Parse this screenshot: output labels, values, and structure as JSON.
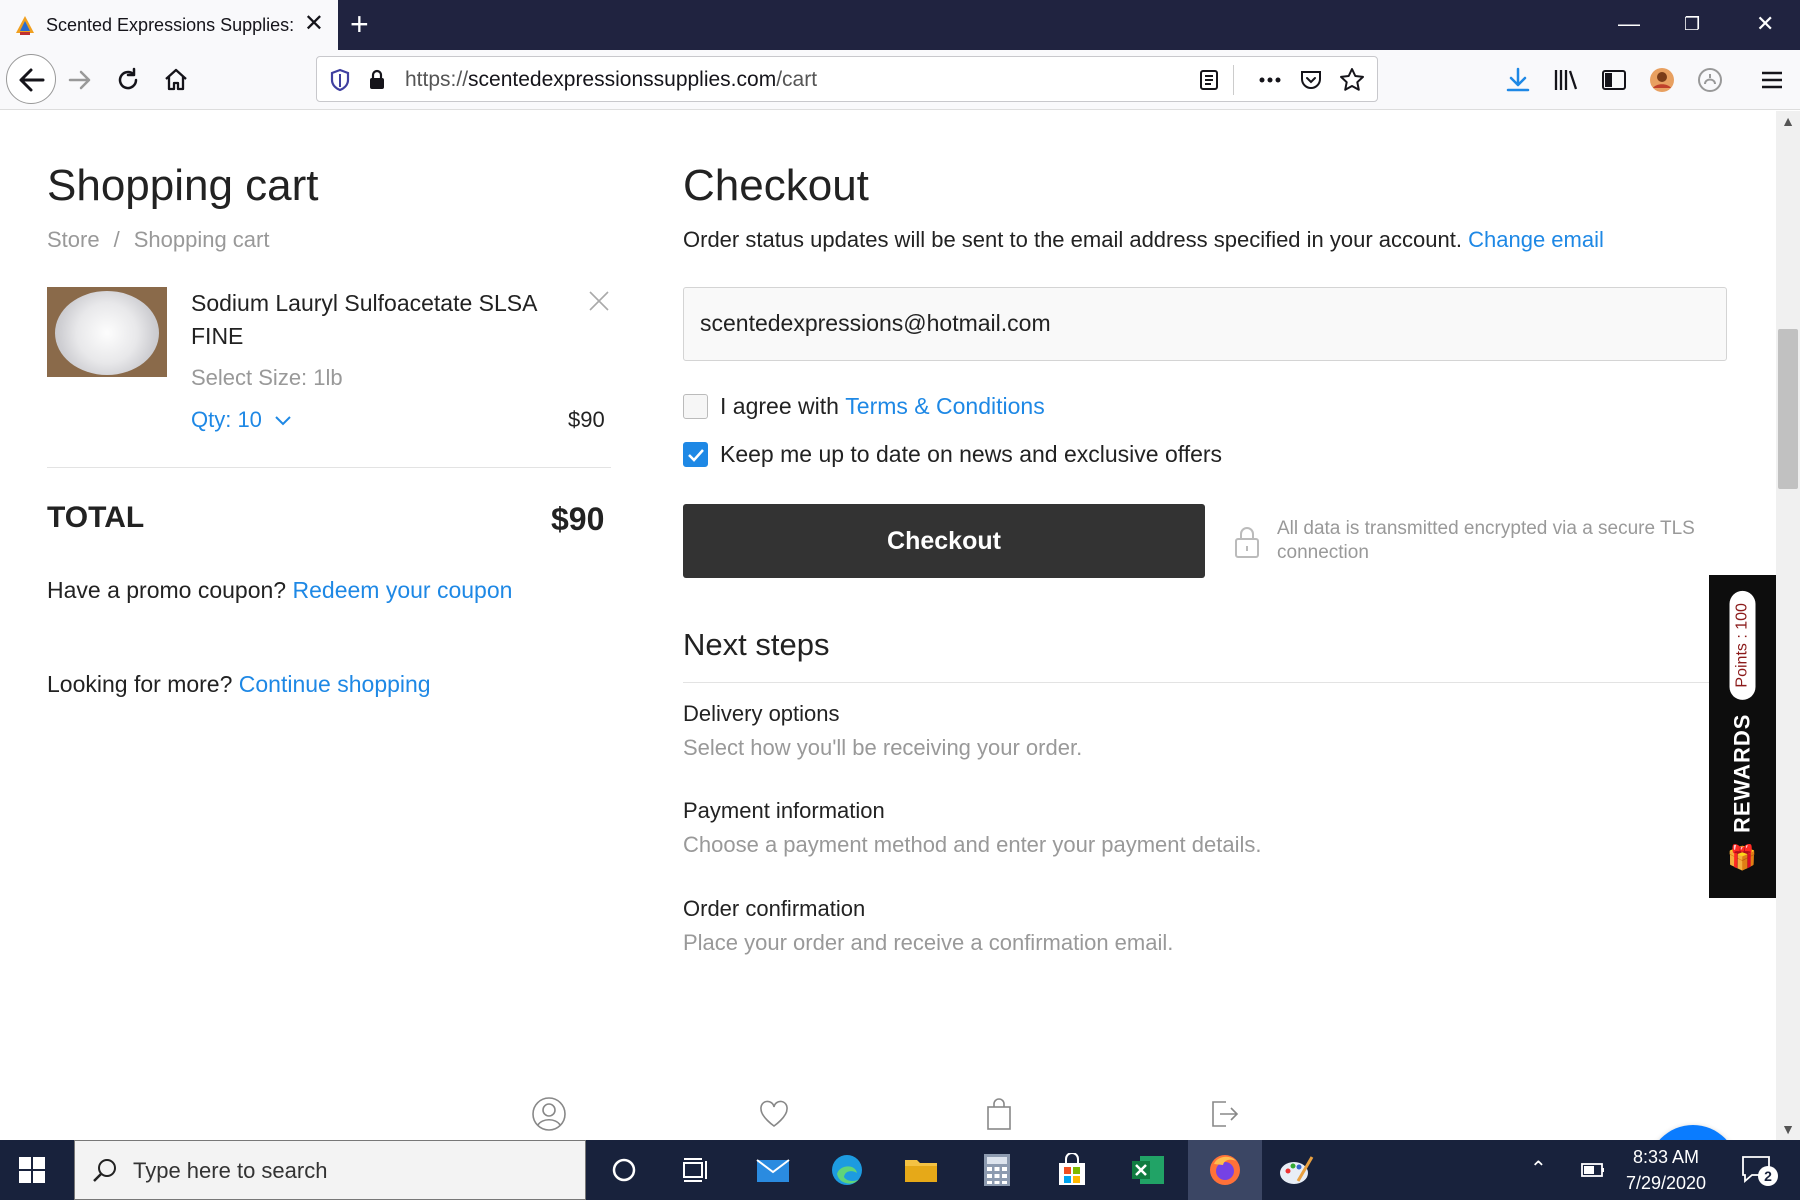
{
  "browser": {
    "tab_title": "Scented Expressions Supplies: C",
    "url_prefix": "https://",
    "url_domain": "scentedexpressionssupplies.com",
    "url_path": "/cart"
  },
  "cart": {
    "title": "Shopping cart",
    "breadcrumb": [
      "Store",
      "/",
      "Shopping cart"
    ],
    "item": {
      "name": "Sodium Lauryl Sulfoacetate SLSA FINE",
      "size": "Select Size: 1lb",
      "qty": "Qty: 10",
      "price": "$90"
    },
    "total_label": "TOTAL",
    "total_value": "$90",
    "promo_text": "Have a promo coupon?",
    "promo_link": "Redeem your coupon",
    "more_text": "Looking for more?",
    "more_link": "Continue shopping"
  },
  "checkout": {
    "title": "Checkout",
    "notice": "Order status updates will be sent to the email address specified in your account.",
    "change_email": "Change email",
    "email": "scentedexpressions@hotmail.com",
    "agree_text": "I agree with",
    "terms_link": "Terms & Conditions",
    "agree_checked": false,
    "newsletter_text": "Keep me up to date on news and exclusive offers",
    "newsletter_checked": true,
    "button": "Checkout",
    "secure_text": "All data is transmitted encrypted via a secure TLS connection",
    "next_title": "Next steps",
    "steps": [
      {
        "title": "Delivery options",
        "desc": "Select how you'll be receiving your order."
      },
      {
        "title": "Payment information",
        "desc": "Choose a payment method and enter your payment details."
      },
      {
        "title": "Order confirmation",
        "desc": "Place your order and receive a confirmation email."
      }
    ]
  },
  "rewards": {
    "label": "REWARDS",
    "points": "Points : 100"
  },
  "taskbar": {
    "search_placeholder": "Type here to search",
    "time": "8:33 AM",
    "date": "7/29/2020",
    "notifications": "2"
  },
  "colors": {
    "accent": "#1e88e5",
    "titlebar": "#202340",
    "button": "#333333",
    "taskbar": "#18223c"
  }
}
